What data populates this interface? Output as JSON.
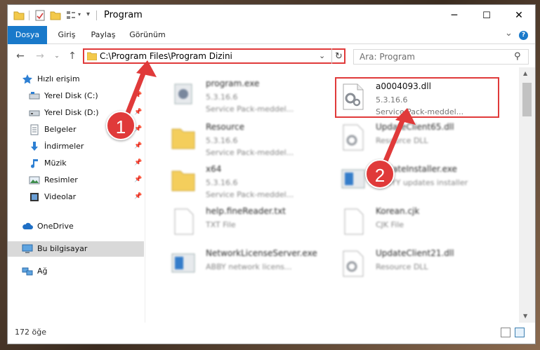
{
  "window": {
    "title": "Program",
    "minimize": "─",
    "maximize": "☐",
    "close": "✕"
  },
  "ribbon": {
    "tabs": [
      "Dosya",
      "Giriş",
      "Paylaş",
      "Görünüm"
    ],
    "collapse": "⌄",
    "help": "?"
  },
  "address": {
    "path": "C:\\Program Files\\Program Dizini",
    "search_placeholder": "Ara: Program"
  },
  "sidebar": {
    "quick_access": "Hızlı erişim",
    "items": [
      {
        "label": "Yerel Disk (C:)",
        "icon": "drive-icon"
      },
      {
        "label": "Yerel Disk (D:)",
        "icon": "drive-icon"
      },
      {
        "label": "Belgeler",
        "icon": "documents-icon"
      },
      {
        "label": "İndirmeler",
        "icon": "downloads-icon"
      },
      {
        "label": "Müzik",
        "icon": "music-icon"
      },
      {
        "label": "Resimler",
        "icon": "pictures-icon"
      },
      {
        "label": "Videolar",
        "icon": "videos-icon"
      }
    ],
    "onedrive": "OneDrive",
    "this_pc": "Bu bilgisayar",
    "network": "Ağ"
  },
  "files": [
    {
      "name": "program.exe",
      "version": "5.3.16.6",
      "desc": "Service Pack-meddel...",
      "kind": "exe"
    },
    {
      "name": "a0004093.dll",
      "version": "5.3.16.6",
      "desc": "Service Pack-meddel...",
      "kind": "dll"
    },
    {
      "name": "Resource",
      "version": "5.3.16.6",
      "desc": "Service Pack-meddel...",
      "kind": "folder"
    },
    {
      "name": "UpdateClient65.dll",
      "version": "Resource DLL",
      "desc": "",
      "kind": "dll"
    },
    {
      "name": "x64",
      "version": "5.3.16.6",
      "desc": "Service Pack-meddel...",
      "kind": "folder"
    },
    {
      "name": "UpdateInstaller.exe",
      "version": "ABBYY updates installer",
      "desc": "",
      "kind": "exe2"
    },
    {
      "name": "help.fineReader.txt",
      "version": "TXT File",
      "desc": "",
      "kind": "txt"
    },
    {
      "name": "Korean.cjk",
      "version": "CJK File",
      "desc": "",
      "kind": "txt"
    },
    {
      "name": "NetworkLicenseServer.exe",
      "version": "ABBY network licens...",
      "desc": "",
      "kind": "exe2"
    },
    {
      "name": "UpdateClient21.dll",
      "version": "Resource DLL",
      "desc": "",
      "kind": "dll"
    }
  ],
  "status": {
    "count": "172 öğe"
  },
  "callouts": [
    "1",
    "2"
  ],
  "colors": {
    "accent": "#1979ca",
    "highlight": "#e03a3a",
    "folder": "#f3c94b"
  }
}
